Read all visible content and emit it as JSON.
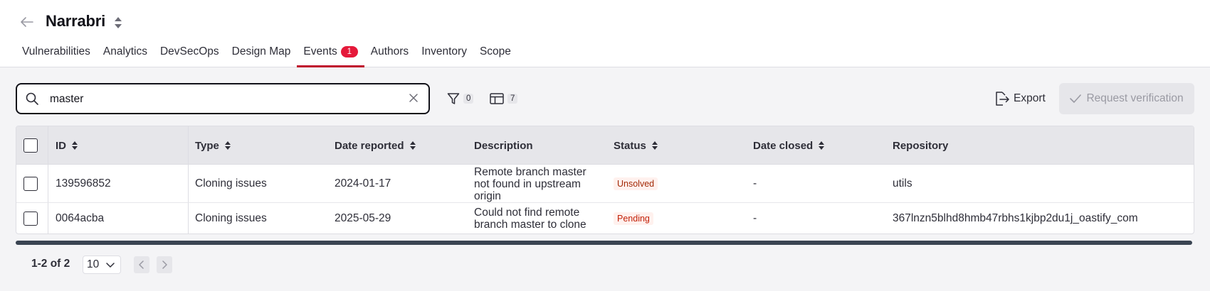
{
  "header": {
    "title": "Narrabri"
  },
  "tabs": [
    {
      "label": "Vulnerabilities"
    },
    {
      "label": "Analytics"
    },
    {
      "label": "DevSecOps"
    },
    {
      "label": "Design Map"
    },
    {
      "label": "Events",
      "badge": "1"
    },
    {
      "label": "Authors"
    },
    {
      "label": "Inventory"
    },
    {
      "label": "Scope"
    }
  ],
  "search": {
    "value": "master"
  },
  "filters": {
    "filter_count": "0",
    "columns_count": "7"
  },
  "actions": {
    "export_label": "Export",
    "request_label": "Request verification"
  },
  "table": {
    "headers": {
      "id": "ID",
      "type": "Type",
      "date_reported": "Date reported",
      "description": "Description",
      "status": "Status",
      "date_closed": "Date closed",
      "repository": "Repository"
    },
    "rows": [
      {
        "id": "139596852",
        "type": "Cloning issues",
        "date_reported": "2024-01-17",
        "description_lines": [
          "Remote branch master",
          "not found in upstream",
          "origin"
        ],
        "status": "Unsolved",
        "date_closed": "-",
        "repository": "utils"
      },
      {
        "id": "0064acba",
        "type": "Cloning issues",
        "date_reported": "2025-05-29",
        "description_lines": [
          "Could not find remote",
          "branch master to clone"
        ],
        "status": "Pending",
        "date_closed": "-",
        "repository": "367lnzn5blhd8hmb47rbhs1kjbp2du1j_oastify_com"
      }
    ]
  },
  "pagination": {
    "range_text": "1-2 of 2",
    "page_size": "10"
  },
  "colors": {
    "accent": "#bf0b2c",
    "badge": "#e5193a",
    "dark": "#121219",
    "status_unsolved": "#a32a07",
    "status_pending": "#c32108"
  }
}
